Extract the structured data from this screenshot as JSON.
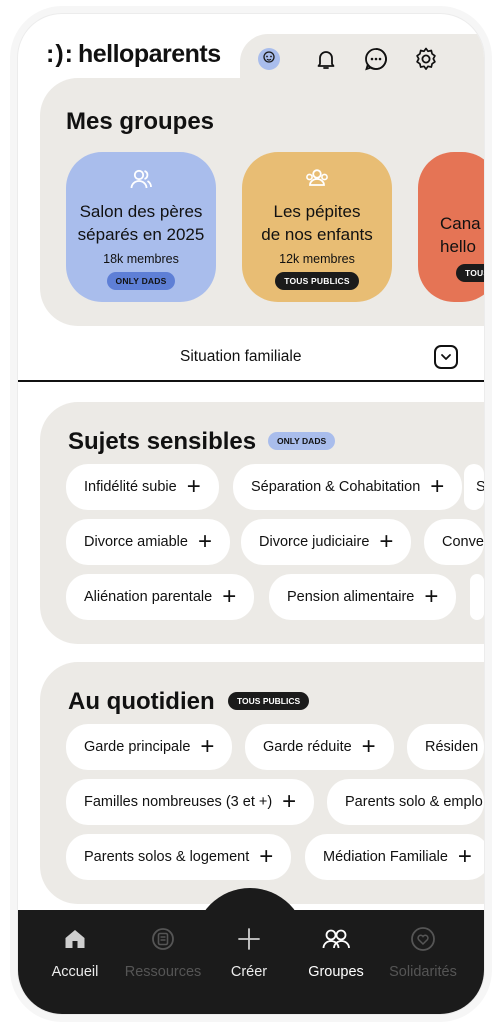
{
  "header": {
    "logo_symbol": ":):",
    "logo_text": "helloparents",
    "icons": [
      "avatar-icon",
      "bell-icon",
      "chat-bubble-icon",
      "gear-icon"
    ]
  },
  "groups": {
    "title": "Mes groupes",
    "cards": [
      {
        "name_line1": "Salon des pères",
        "name_line2": "séparés en 2025",
        "members": "18k membres",
        "badge": "ONLY DADS",
        "color": "#a9bdec",
        "badge_color": "#5e7fd6"
      },
      {
        "name_line1": "Les pépites",
        "name_line2": "de nos enfants",
        "members": "12k membres",
        "badge": "TOUS PUBLICS",
        "color": "#e8bd74",
        "badge_color": "#1b1b1b"
      },
      {
        "name_line1": "Cana",
        "name_line2": "hello",
        "members": "",
        "badge": "TOUS",
        "color": "#e57455",
        "badge_color": "#1b1b1b"
      }
    ]
  },
  "situation": {
    "label": "Situation familiale",
    "icon": "chevron-down-icon"
  },
  "sensitive": {
    "title": "Sujets sensibles",
    "badge": "ONLY DADS",
    "chips": [
      "Infidélité subie",
      "Séparation & Cohabitation",
      "S",
      "Divorce amiable",
      "Divorce judiciaire",
      "Conve",
      "Aliénation parentale",
      "Pension alimentaire"
    ]
  },
  "daily": {
    "title": "Au quotidien",
    "badge": "TOUS PUBLICS",
    "chips": [
      "Garde principale",
      "Garde réduite",
      "Résiden",
      "Familles nombreuses (3 et +)",
      "Parents solo & emplo",
      "Parents solos & logement",
      "Médiation Familiale"
    ]
  },
  "nav": {
    "items": [
      {
        "label": "Accueil",
        "icon": "home-icon",
        "state": "active"
      },
      {
        "label": "Ressources",
        "icon": "document-icon",
        "state": "disabled"
      },
      {
        "label": "Créer",
        "icon": "plus-icon",
        "state": "active"
      },
      {
        "label": "Groupes",
        "icon": "groups-icon",
        "state": "selected"
      },
      {
        "label": "Solidarités",
        "icon": "heart-icon",
        "state": "disabled"
      }
    ]
  },
  "colors": {
    "panel": "#eceae6",
    "nav_bg": "#1b1b1b",
    "only_dads_badge": "#a9bdec",
    "disabled_nav": "#555555"
  }
}
